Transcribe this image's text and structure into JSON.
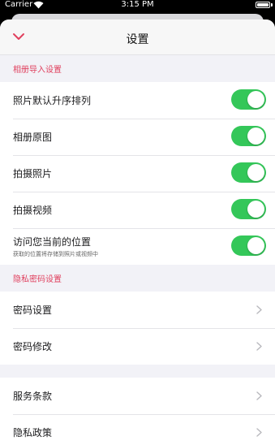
{
  "status_bar": {
    "carrier": "Carrier",
    "time": "3:15 PM"
  },
  "nav": {
    "title": "设置",
    "back_icon": "chevron-down-icon"
  },
  "colors": {
    "accent": "#e0405e",
    "toggle_on": "#34c759",
    "background": "#f2f2f7"
  },
  "sections": [
    {
      "header": "相册导入设置",
      "rows": [
        {
          "label": "照片默认升序排列",
          "toggle_on": true
        },
        {
          "label": "相册原图",
          "toggle_on": true
        },
        {
          "label": "拍摄照片",
          "toggle_on": true
        },
        {
          "label": "拍摄视频",
          "toggle_on": true
        },
        {
          "label": "访问您当前的位置",
          "sub": "获取的位置将存储到照片或视频中",
          "toggle_on": true
        }
      ]
    },
    {
      "header": "隐私密码设置",
      "rows": [
        {
          "label": "密码设置"
        },
        {
          "label": "密码修改"
        }
      ]
    },
    {
      "rows": [
        {
          "label": "服务条款"
        },
        {
          "label": "隐私政策"
        }
      ]
    }
  ]
}
